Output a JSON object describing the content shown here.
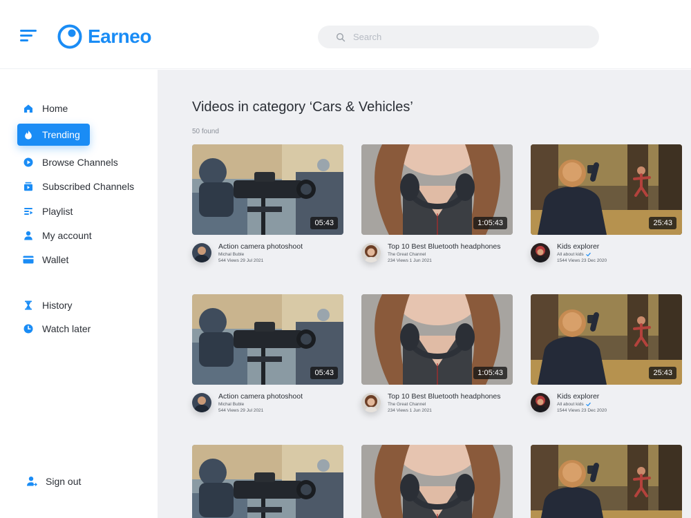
{
  "app": {
    "name": "Earneo"
  },
  "search": {
    "placeholder": "Search"
  },
  "sidebar": {
    "items": [
      {
        "label": "Home",
        "icon": "home-icon"
      },
      {
        "label": "Trending",
        "icon": "flame-icon",
        "active": true
      },
      {
        "label": "Browse Channels",
        "icon": "play-circle-icon"
      },
      {
        "label": "Subscribed Channels",
        "icon": "subscriptions-icon"
      },
      {
        "label": "Playlist",
        "icon": "playlist-icon"
      },
      {
        "label": "My account",
        "icon": "user-icon"
      },
      {
        "label": "Wallet",
        "icon": "wallet-icon"
      },
      {
        "label": "History",
        "icon": "hourglass-icon"
      },
      {
        "label": "Watch later",
        "icon": "clock-icon"
      }
    ],
    "signout": {
      "label": "Sign out",
      "icon": "user-logout-icon"
    }
  },
  "main": {
    "title": "Videos in category ‘Cars & Vehicles’",
    "found": "50 found",
    "videos": [
      {
        "title": "Action camera photoshoot",
        "channel": "Michal Buble",
        "stats": "544 Views 29 Jul 2021",
        "duration": "05:43",
        "verified": false
      },
      {
        "title": "Top 10 Best Bluetooth headphones",
        "channel": "The Great Channel",
        "stats": "234 Views 1 Jun 2021",
        "duration": "1:05:43",
        "verified": false
      },
      {
        "title": "Kids explorer",
        "channel": "All about kids",
        "stats": "1544 Views 23 Dec 2020",
        "duration": "25:43",
        "verified": true
      },
      {
        "title": "Action camera photoshoot",
        "channel": "Michal Buble",
        "stats": "544 Views 29 Jul 2021",
        "duration": "05:43",
        "verified": false
      },
      {
        "title": "Top 10 Best Bluetooth headphones",
        "channel": "The Great Channel",
        "stats": "234 Views 1 Jun 2021",
        "duration": "1:05:43",
        "verified": false
      },
      {
        "title": "Kids explorer",
        "channel": "All about kids",
        "stats": "1544 Views 23 Dec 2020",
        "duration": "25:43",
        "verified": true
      },
      {
        "title": "",
        "channel": "",
        "stats": "",
        "duration": "",
        "verified": false
      },
      {
        "title": "",
        "channel": "",
        "stats": "",
        "duration": "",
        "verified": false
      },
      {
        "title": "",
        "channel": "",
        "stats": "",
        "duration": "",
        "verified": false
      }
    ]
  },
  "colors": {
    "accent": "#1a8cf5",
    "background": "#eff0f3",
    "text": "#2b2f36"
  }
}
